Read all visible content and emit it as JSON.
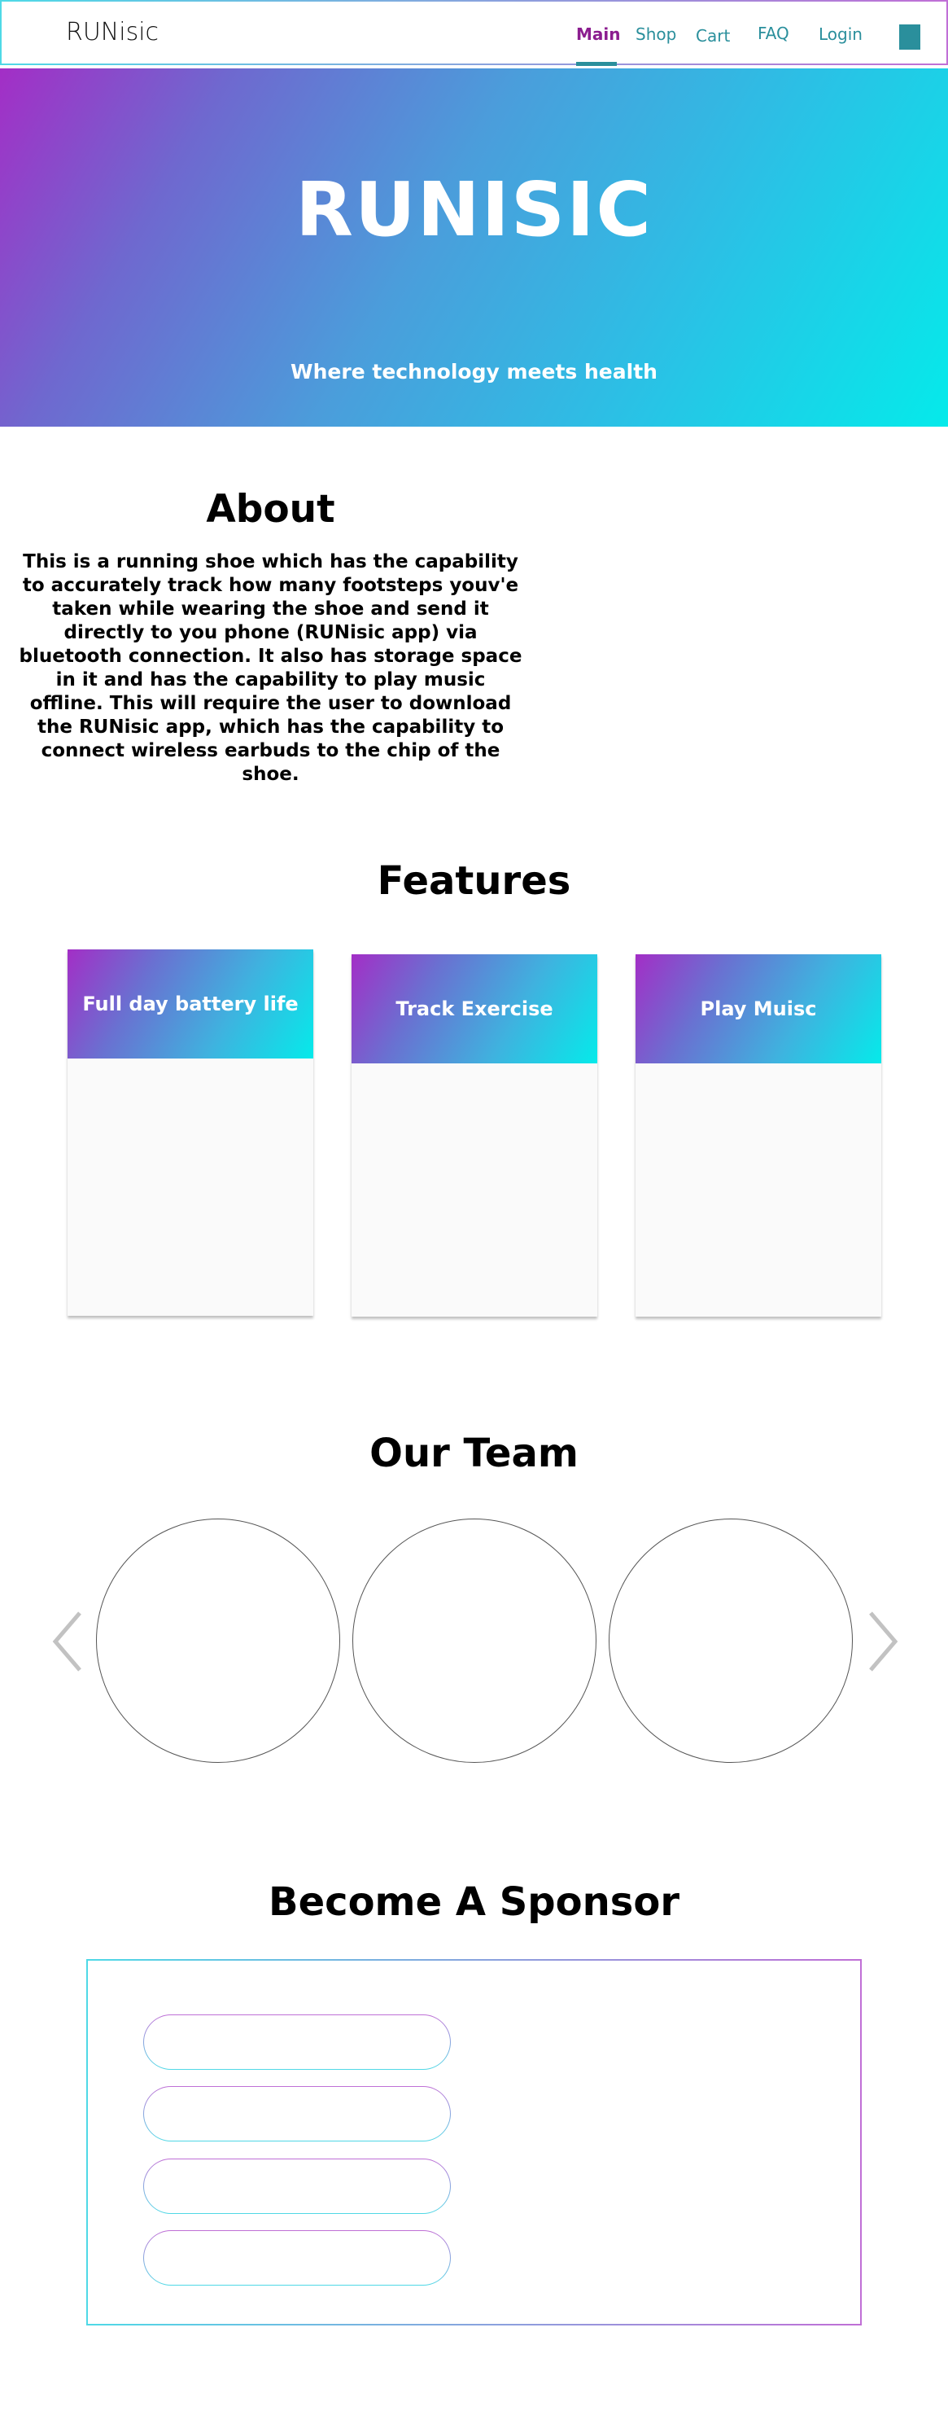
{
  "nav": {
    "brand": "RUNisic",
    "links": [
      {
        "label": "Main",
        "active": true
      },
      {
        "label": "Shop",
        "active": false
      },
      {
        "label": "Cart",
        "active": false
      },
      {
        "label": "FAQ",
        "active": false
      },
      {
        "label": "Login",
        "active": false
      }
    ]
  },
  "hero": {
    "title": "RUNISIC",
    "subtitle": "Where technology meets health"
  },
  "about": {
    "title": "About",
    "text": "This is a running shoe which has the capability to accurately track how many footsteps youv'e taken while wearing the shoe and send it directly to you phone (RUNisic app) via bluetooth connection. It also has storage space in it and has the capability to play music offline. This will require the user to download the RUNisic app, which has the capability to connect wireless earbuds to the chip of the shoe."
  },
  "features": {
    "title": "Features",
    "cards": [
      {
        "title": "Full day battery life"
      },
      {
        "title": "Track Exercise"
      },
      {
        "title": "Play Muisc"
      }
    ]
  },
  "team": {
    "title": "Our Team",
    "prev_icon": "chevron-left-icon",
    "next_icon": "chevron-right-icon"
  },
  "sponsor": {
    "title": "Become A Sponsor",
    "fields": [
      "",
      "",
      "",
      ""
    ]
  },
  "colors": {
    "accent_teal": "#2a8f9c",
    "accent_purple": "#8b1d8f",
    "gradient_start": "#a32ec6",
    "gradient_end": "#05eaea"
  }
}
